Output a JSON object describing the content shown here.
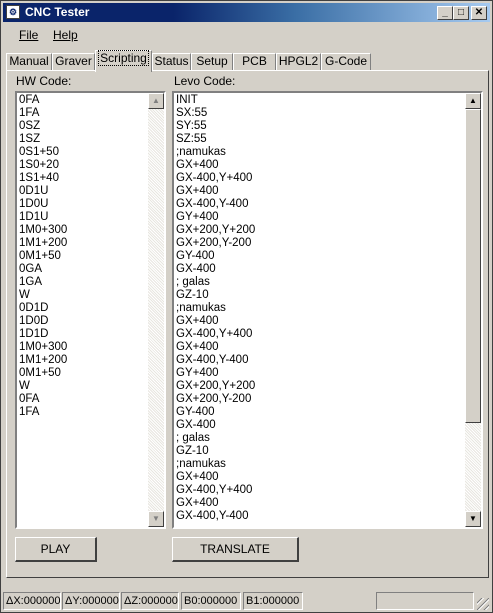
{
  "window": {
    "title": "CNC Tester",
    "icon": "cnc-app-icon",
    "controls": [
      "minimize-icon",
      "maximize-icon",
      "close-icon"
    ]
  },
  "menu": {
    "file": "File",
    "help": "Help"
  },
  "tabs": [
    "Manual",
    "Graver",
    "Scripting",
    "Status",
    "Setup",
    "PCB",
    "HPGL2",
    "G-Code"
  ],
  "active_tab": "Scripting",
  "hw": {
    "label": "HW Code:",
    "lines": [
      "0FA",
      "1FA",
      "0SZ",
      "1SZ",
      "0S1+50",
      "1S0+20",
      "1S1+40",
      "0D1U",
      "1D0U",
      "1D1U",
      "1M0+300",
      "1M1+200",
      "0M1+50",
      "0GA",
      "1GA",
      "W",
      "0D1D",
      "1D0D",
      "1D1D",
      "1M0+300",
      "1M1+200",
      "0M1+50",
      "W",
      "0FA",
      "1FA"
    ]
  },
  "levo": {
    "label": "Levo Code:",
    "lines": [
      "INIT",
      "SX:55",
      "SY:55",
      "SZ:55",
      ";namukas",
      "GX+400",
      "GX-400,Y+400",
      "GX+400",
      "GX-400,Y-400",
      "GY+400",
      "GX+200,Y+200",
      "GX+200,Y-200",
      "GY-400",
      "GX-400",
      "; galas",
      "GZ-10",
      ";namukas",
      "GX+400",
      "GX-400,Y+400",
      "GX+400",
      "GX-400,Y-400",
      "GY+400",
      "GX+200,Y+200",
      "GX+200,Y-200",
      "GY-400",
      "GX-400",
      "; galas",
      "GZ-10",
      ";namukas",
      "GX+400",
      "GX-400,Y+400",
      "GX+400",
      "GX-400,Y-400"
    ]
  },
  "buttons": {
    "play": "PLAY",
    "translate": "TRANSLATE"
  },
  "status": {
    "dx": "ΔX:000000",
    "dy": "ΔY:000000",
    "dz": "ΔZ:000000",
    "b0": "B0:000000",
    "b1": "B1:000000",
    "extra": ""
  }
}
